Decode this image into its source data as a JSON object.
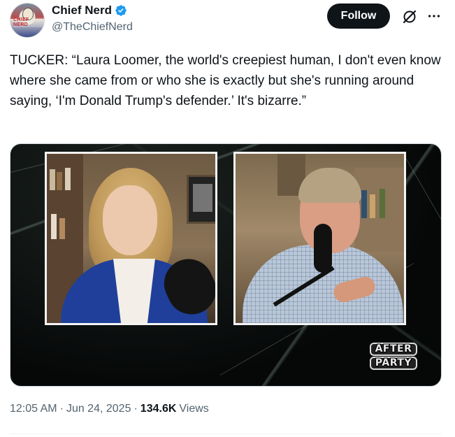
{
  "author": {
    "display_name": "Chief Nerd",
    "handle": "@TheChiefNerd",
    "avatar_text": "CHIEF NERD",
    "verified": true
  },
  "actions": {
    "follow_label": "Follow",
    "grok_icon": "grok-icon",
    "more_icon": "more-icon"
  },
  "tweet": {
    "text": "TUCKER: “Laura Loomer, the world's creepiest human, I don't even know where she came from or who she is exactly but she's running around saying, ‘I'm Donald Trump's defender.’ It's bizarre.”"
  },
  "media": {
    "logo_line1": "AFTER",
    "logo_line2": "PARTY"
  },
  "meta": {
    "time": "12:05 AM",
    "separator1": "·",
    "date": "Jun 24, 2025",
    "separator2": "·",
    "views_count": "134.6K",
    "views_label": "Views"
  },
  "colors": {
    "text_primary": "#0f1419",
    "text_secondary": "#536471",
    "verified_blue": "#1d9bf0",
    "follow_bg": "#0f1419"
  }
}
